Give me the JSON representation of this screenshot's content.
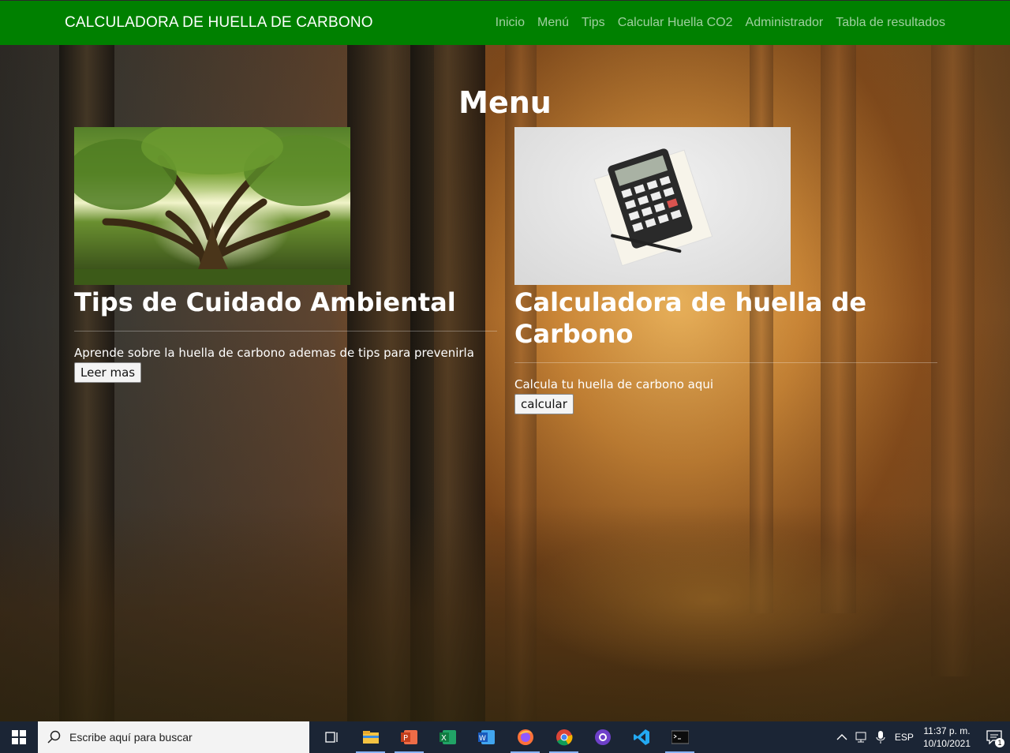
{
  "navbar": {
    "brand": "CALCULADORA DE HUELLA DE CARBONO",
    "links": [
      "Inicio",
      "Menú",
      "Tips",
      "Calcular Huella CO2",
      "Administrador",
      "Tabla de resultados"
    ]
  },
  "main": {
    "heading": "Menu",
    "cards": [
      {
        "title": "Tips de Cuidado Ambiental",
        "description": "Aprende sobre la huella de carbono ademas de tips para prevenirla",
        "button": "Leer mas",
        "image": "tree-photo"
      },
      {
        "title": "Calculadora de huella de Carbono",
        "description": "Calcula tu huella de carbono aqui",
        "button": "calcular",
        "image": "calculator-photo"
      }
    ]
  },
  "taskbar": {
    "search_placeholder": "Escribe aquí para buscar",
    "apps": [
      "task-view-icon",
      "file-explorer-icon",
      "powerpoint-icon",
      "excel-icon",
      "word-icon",
      "firefox-icon",
      "chrome-icon",
      "github-desktop-icon",
      "vscode-icon",
      "terminal-icon"
    ],
    "language": "ESP",
    "time": "11:37 p. m.",
    "date": "10/10/2021",
    "notifications": "1"
  },
  "colors": {
    "navbar": "#008000",
    "taskbar": "#1b2535"
  }
}
